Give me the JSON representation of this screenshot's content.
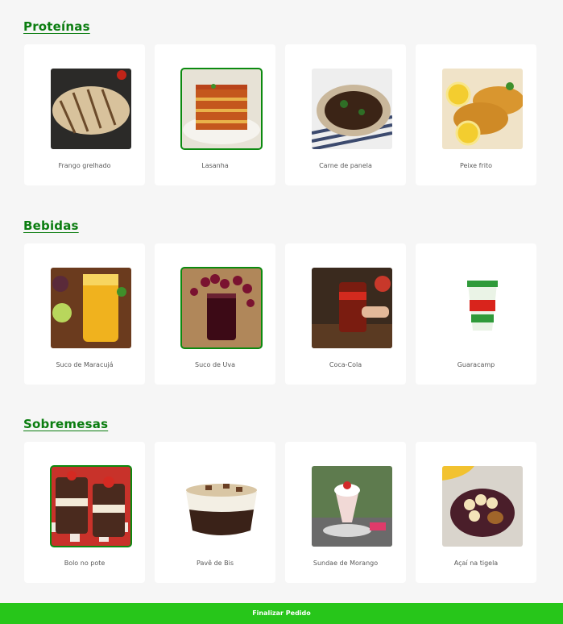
{
  "sections": [
    {
      "title": "Proteínas",
      "items": [
        {
          "label": "Frango grelhado",
          "image": "grilled-chicken-image",
          "selected": false
        },
        {
          "label": "Lasanha",
          "image": "lasagna-image",
          "selected": true
        },
        {
          "label": "Carne de panela",
          "image": "pot-roast-image",
          "selected": false
        },
        {
          "label": "Peixe frito",
          "image": "fried-fish-image",
          "selected": false
        }
      ]
    },
    {
      "title": "Bebidas",
      "items": [
        {
          "label": "Suco de Maracujá",
          "image": "passion-fruit-juice-image",
          "selected": false
        },
        {
          "label": "Suco de Uva",
          "image": "grape-juice-image",
          "selected": true
        },
        {
          "label": "Coca-Cola",
          "image": "coca-cola-image",
          "selected": false
        },
        {
          "label": "Guaracamp",
          "image": "guaracamp-cup-image",
          "selected": false
        }
      ]
    },
    {
      "title": "Sobremesas",
      "items": [
        {
          "label": "Bolo no pote",
          "image": "cake-jar-image",
          "selected": true
        },
        {
          "label": "Pavê de Bis",
          "image": "pave-cup-image",
          "selected": false
        },
        {
          "label": "Sundae de Morango",
          "image": "strawberry-sundae-image",
          "selected": false
        },
        {
          "label": "Açaí na tigela",
          "image": "acai-bowl-image",
          "selected": false
        }
      ]
    }
  ],
  "footer": {
    "button_label": "Finalizar Pedido"
  },
  "colors": {
    "accent": "#0b7d10",
    "button": "#27c61a",
    "selected_border": "#0c8a10"
  }
}
